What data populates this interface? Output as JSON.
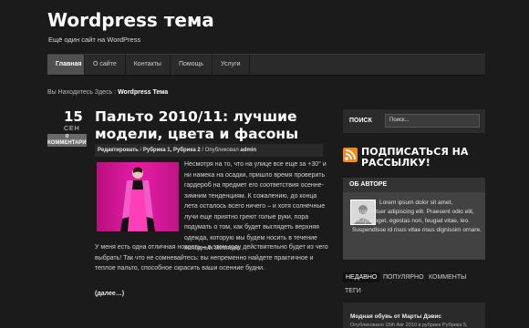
{
  "site": {
    "title": "Wordpress тема",
    "tagline": "Ещё один сайт на WordPress"
  },
  "nav": {
    "items": [
      "Главная",
      "О сайте",
      "Контакты",
      "Помощь",
      "Услуги"
    ]
  },
  "breadcrumb": {
    "prefix": "Вы Находитесь Здесь : ",
    "current": "Wordpress Тема"
  },
  "post": {
    "day": "15",
    "month": "СЕН",
    "comments": "0 КОММЕНТАРИЕВ",
    "title": "Пальто 2010/11: лучшие модели, цвета и фасоны",
    "meta_edit": "Редактировать",
    "meta_sep1": " / ",
    "meta_rubrics": "Рубрика 1, Рубрика 2",
    "meta_published": " / Опубликовал ",
    "meta_author": "admin",
    "text1": "Несмотря на то, что на улице все еще за +30° и ни намека на осадки, пришло время проверить гардероб на предмет его соответствия осенне-зимним тенденциям. К сожалению, до конца лета осталось всего ничего – и хотя солнечные лучи еще приятно греют голые руки, пора подумать о том, как будет выглядеть верхняя одежда, которую мы будем носить в течение холодных месяцев.",
    "text2": "У меня есть одна отличная новость – в этом году действительно будет из чего выбрать! Так что не сомневайтесь: вы непременно найдете практичное и теплое пальто, способное скрасить ваши осенние будни.",
    "read_more": "(далее…)"
  },
  "search": {
    "label": "ПОИСК",
    "placeholder": "Поиск..."
  },
  "subscribe": {
    "label": "ПОДПИСАТЬСЯ НА РАССЫЛКУ!"
  },
  "author": {
    "heading": "ОБ АВТОРЕ",
    "text": "Lorem ipsum dolor sit amet, consectetuer adipiscing elit. Praesent odio elit, volutpat eget, egestas non, feugiat vitae, leo. Suspendisse id risus vitae risus dignissim ornare."
  },
  "tabs": [
    "НЕДАВНО",
    "ПОПУЛЯРНО",
    "КОММЕНТЫ",
    "ТЕГИ"
  ],
  "recent": {
    "title": "Модная обувь от Марты Дэвис",
    "meta": "Опубликовано 15th Авг 2010 в рубрике Рубрика 5,"
  },
  "colors": {
    "background": "#1b1b1b",
    "rss": "#f08a1c",
    "image": "#e01aa0"
  }
}
